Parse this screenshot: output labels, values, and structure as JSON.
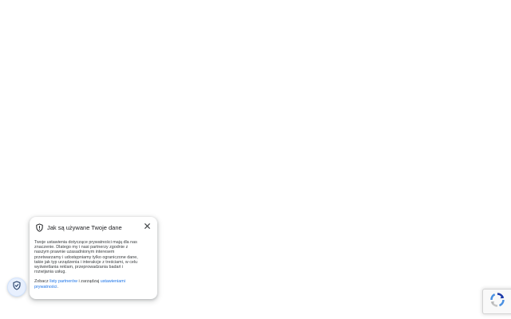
{
  "privacy_popup": {
    "title": "Jak są używane Twoje dane",
    "body": "Twoje ustawienia dotyczące prywatności mają dla nas znaczenie. Dlatego my i nasi partnerzy zgodnie z naszym prawnie uzasadnionym interesem przetwarzamy i udostępniamy tylko ograniczone dane, takie jak typ urządzenia i interakcje z treściami, w celu wyświetlania reklam, przeprowadzania badań i rozwijania usług.",
    "footer_prefix": "Zobacz ",
    "partners_link": "listy partnerów",
    "footer_middle": " i zarządzaj ",
    "settings_link": "ustawieniami prywatności",
    "footer_suffix": ".",
    "close_icon": "close-icon",
    "header_icon": "shield-icon"
  },
  "privacy_fab": {
    "icon": "shield-check-icon"
  },
  "recaptcha": {
    "icon": "recaptcha-icon"
  },
  "colors": {
    "link": "#1a73e8",
    "fab_bg": "#e8f0fe",
    "recaptcha_blue": "#4a90e2"
  }
}
